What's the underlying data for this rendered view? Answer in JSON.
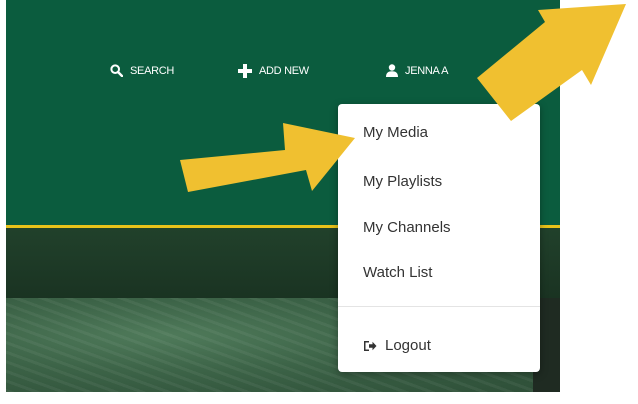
{
  "nav": {
    "search_label": "SEARCH",
    "add_new_label": "ADD NEW",
    "user_label": "JENNA A"
  },
  "user_menu": {
    "items": [
      {
        "label": "My Media"
      },
      {
        "label": "My Playlists"
      },
      {
        "label": "My Channels"
      },
      {
        "label": "Watch List"
      }
    ],
    "logout_label": "Logout"
  },
  "colors": {
    "header_green": "#0b5c3e",
    "accent_gold": "#e8c21a",
    "arrow_gold": "#f0c030"
  },
  "icons": {
    "search": "search-icon",
    "add": "plus-icon",
    "user": "user-icon",
    "logout": "logout-icon",
    "arrows": "pointer-arrow-icon"
  }
}
